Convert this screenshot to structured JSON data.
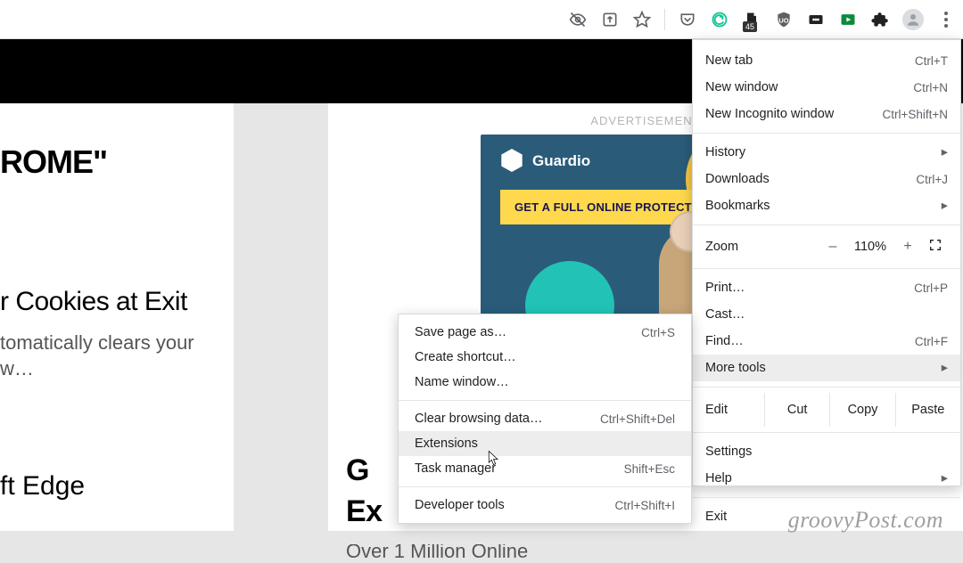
{
  "toolbar": {
    "badge_count": "45"
  },
  "page": {
    "headline_fragment": "ROME\"",
    "subhead": "r Cookies at Exit",
    "para": "tomatically clears your w…",
    "edge": "ft Edge",
    "ad_label": "ADVERTISEMENT",
    "ad_brand": "Guardio",
    "ad_cta": "GET A FULL ONLINE PROTECTION",
    "ad_tri_label": "▷",
    "ad_x_label": "✕",
    "mid_line1": "G",
    "mid_line2": "Ex",
    "mid_sub": "Over 1 Million Online"
  },
  "menu": {
    "new_tab": "New tab",
    "new_tab_sc": "Ctrl+T",
    "new_window": "New window",
    "new_window_sc": "Ctrl+N",
    "incognito": "New Incognito window",
    "incognito_sc": "Ctrl+Shift+N",
    "history": "History",
    "downloads": "Downloads",
    "downloads_sc": "Ctrl+J",
    "bookmarks": "Bookmarks",
    "zoom_label": "Zoom",
    "zoom_minus": "–",
    "zoom_value": "110%",
    "zoom_plus": "+",
    "print": "Print…",
    "print_sc": "Ctrl+P",
    "cast": "Cast…",
    "find": "Find…",
    "find_sc": "Ctrl+F",
    "more_tools": "More tools",
    "edit": "Edit",
    "cut": "Cut",
    "copy": "Copy",
    "paste": "Paste",
    "settings": "Settings",
    "help": "Help",
    "exit": "Exit"
  },
  "submenu": {
    "save_page": "Save page as…",
    "save_page_sc": "Ctrl+S",
    "create_shortcut": "Create shortcut…",
    "name_window": "Name window…",
    "clear_browsing": "Clear browsing data…",
    "clear_browsing_sc": "Ctrl+Shift+Del",
    "extensions": "Extensions",
    "task_manager": "Task manager",
    "task_manager_sc": "Shift+Esc",
    "developer_tools": "Developer tools",
    "developer_tools_sc": "Ctrl+Shift+I"
  },
  "watermark": "groovyPost.com"
}
